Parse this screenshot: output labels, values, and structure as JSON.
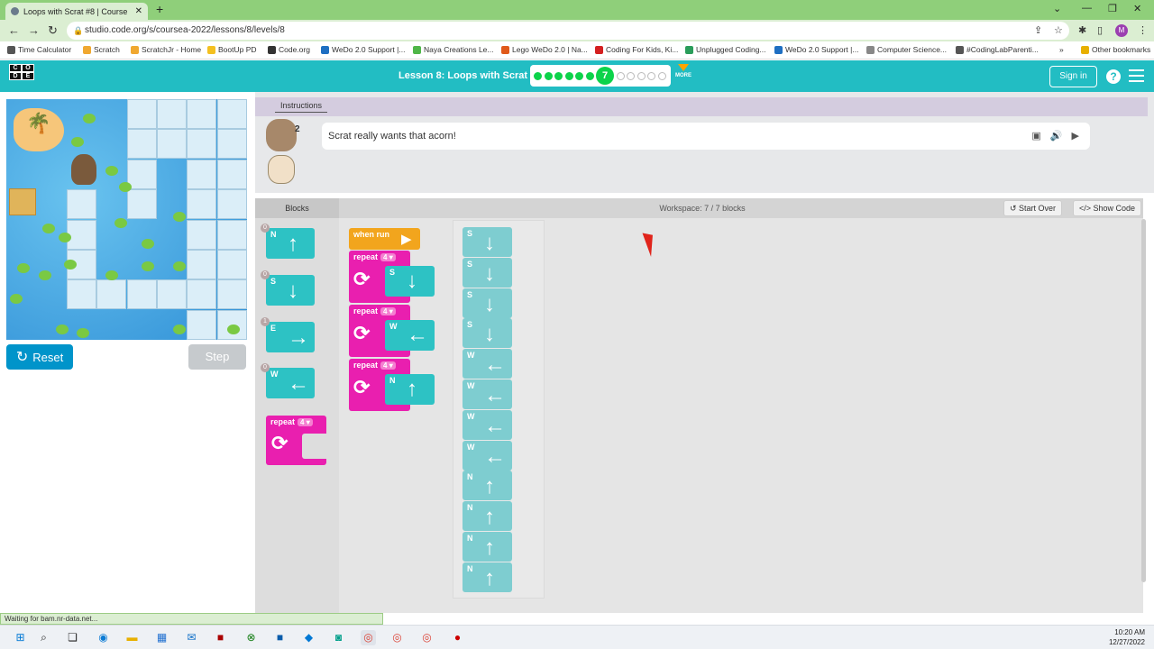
{
  "browser": {
    "tab_title": "Loops with Scrat #8 | Course",
    "url": "studio.code.org/s/coursea-2022/lessons/8/levels/8",
    "bookmarks": [
      {
        "label": "Time Calculator",
        "color": "#555"
      },
      {
        "label": "Scratch",
        "color": "#f0a830"
      },
      {
        "label": "ScratchJr - Home",
        "color": "#f0a830"
      },
      {
        "label": "BootUp PD",
        "color": "#f4c020"
      },
      {
        "label": "Code.org",
        "color": "#333"
      },
      {
        "label": "WeDo 2.0 Support |...",
        "color": "#1e6fc2"
      },
      {
        "label": "Naya Creations Le...",
        "color": "#4fb648"
      },
      {
        "label": "Lego WeDo 2.0 | Na...",
        "color": "#e05a1a"
      },
      {
        "label": "Coding For Kids, Ki...",
        "color": "#d42020"
      },
      {
        "label": "Unplugged Coding...",
        "color": "#2a9d5a"
      },
      {
        "label": "WeDo 2.0 Support |...",
        "color": "#1e6fc2"
      },
      {
        "label": "Computer Science...",
        "color": "#888"
      },
      {
        "label": "#CodingLabParenti...",
        "color": "#555"
      }
    ],
    "other_bookmarks": "Other bookmarks",
    "profile_initial": "M",
    "status_text": "Waiting for bam.nr-data.net..."
  },
  "header": {
    "logo_letters": [
      "C",
      "O",
      "D",
      "E"
    ],
    "lesson_title": "Lesson 8: Loops with Scrat",
    "current_level": "7",
    "more_label": "MORE",
    "signin_label": "Sign in",
    "help_label": "?"
  },
  "game": {
    "reset_label": "Reset",
    "step_label": "Step"
  },
  "instructions": {
    "tab_label": "Instructions",
    "text": "Scrat really wants that acorn!",
    "hint_count": "2"
  },
  "toolbox": {
    "title": "Blocks",
    "blocks": [
      {
        "dir": "N",
        "count": "0"
      },
      {
        "dir": "S",
        "count": "0"
      },
      {
        "dir": "E",
        "count": "1"
      },
      {
        "dir": "W",
        "count": "0"
      }
    ],
    "repeat_label": "repeat",
    "repeat_value": "4"
  },
  "workspace": {
    "title": "Workspace: 7 / 7 blocks",
    "start_over_label": "Start Over",
    "show_code_label": "Show Code",
    "when_run_label": "when run",
    "repeat_label": "repeat",
    "repeats": [
      {
        "times": "4",
        "dir": "S"
      },
      {
        "times": "4",
        "dir": "W"
      },
      {
        "times": "4",
        "dir": "N"
      }
    ],
    "strip_blocks": [
      "S",
      "S",
      "S",
      "S",
      "W",
      "W",
      "W",
      "W",
      "N",
      "N",
      "N",
      "N"
    ]
  },
  "taskbar": {
    "time": "10:20 AM",
    "date": "12/27/2022"
  }
}
